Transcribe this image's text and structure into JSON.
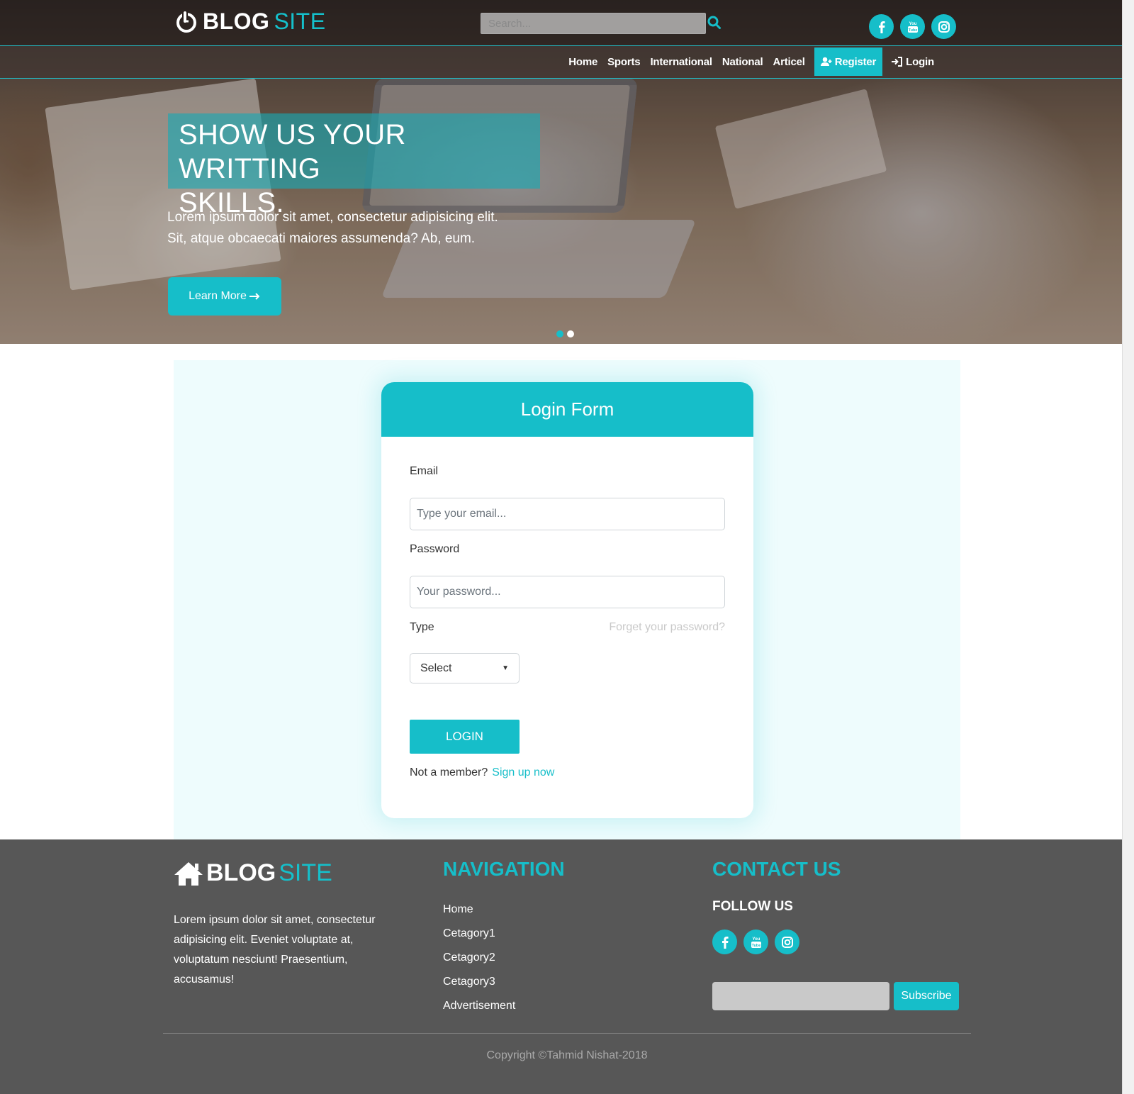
{
  "brand": {
    "bold": "BLOG",
    "light": "SITE"
  },
  "search": {
    "placeholder": "Search..."
  },
  "social": [
    "facebook-icon",
    "youtube-icon",
    "instagram-icon"
  ],
  "nav": {
    "items": [
      "Home",
      "Sports",
      "International",
      "National",
      "Articel"
    ],
    "register": "Register",
    "login": "Login"
  },
  "hero": {
    "title_line1": "SHOW US YOUR WRITTING",
    "title_line2": "SKILLS.",
    "subtitle_line1": "Lorem ipsum dolor sit amet, consectetur adipisicing elit.",
    "subtitle_line2": "Sit, atque obcaecati maiores assumenda? Ab, eum.",
    "cta": "Learn More",
    "slides": 2,
    "active_slide": 1
  },
  "login_form": {
    "title": "Login Form",
    "email_label": "Email",
    "email_placeholder": "Type your email...",
    "password_label": "Password",
    "password_placeholder": "Your password...",
    "type_label": "Type",
    "forget_link": "Forget your password?",
    "select_value": "Select",
    "submit": "LOGIN",
    "not_member": "Not a member?",
    "signup_link": "Sign up now"
  },
  "footer": {
    "brand": {
      "bold": "BLOG",
      "light": "SITE"
    },
    "about": "Lorem ipsum dolor sit amet, consectetur adipisicing elit. Eveniet voluptate at, voluptatum nesciunt! Praesentium, accusamus!",
    "nav_heading": "NAVIGATION",
    "nav_items": [
      "Home",
      "Cetagory1",
      "Cetagory2",
      "Cetagory3",
      "Advertisement"
    ],
    "contact_heading": "CONTACT US",
    "follow": "FOLLOW US",
    "subscribe": "Subscribe",
    "copyright": "Copyright ©Tahmid Nishat-2018"
  },
  "colors": {
    "accent": "#16bec9",
    "footer_bg": "#575757",
    "section_bg": "#eefcfd"
  }
}
